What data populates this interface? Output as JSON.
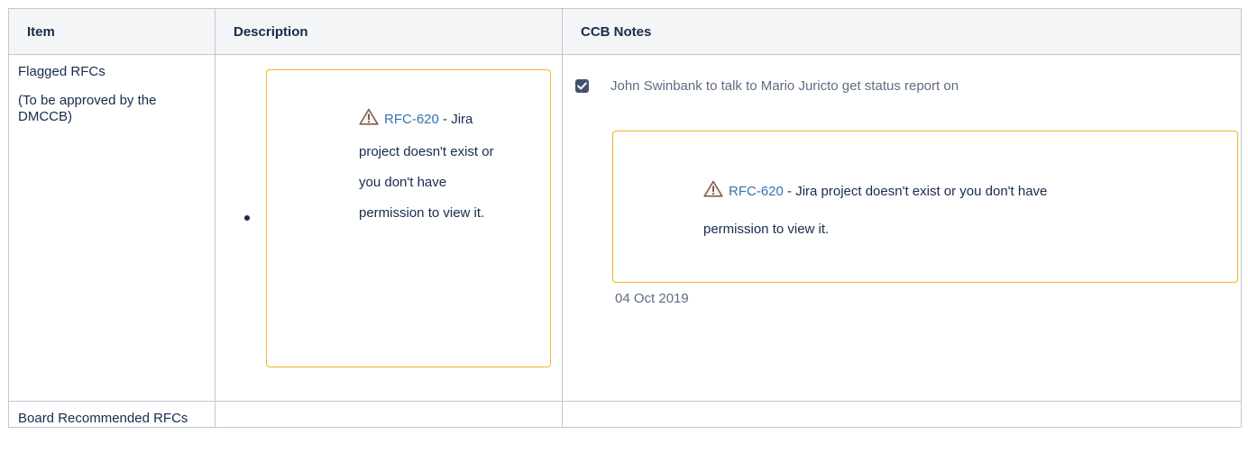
{
  "table": {
    "headers": {
      "item": "Item",
      "description": "Description",
      "notes": "CCB Notes"
    },
    "rows": [
      {
        "item_title": "Flagged RFCs",
        "item_sub": "(To be approved by the DMCCB)"
      },
      {
        "item_title": "Board Recommended RFCs"
      }
    ]
  },
  "description": {
    "jira": {
      "link_text": "RFC-620",
      "separator": " -",
      "message": "Jira project doesn't exist or you don't have permission to view it."
    }
  },
  "notes": {
    "task": {
      "checked": true,
      "text": "John Swinbank to talk to Mario Juricto get status report on"
    },
    "jira": {
      "link_text": "RFC-620",
      "message_line1": " - Jira project doesn't exist or you don't have",
      "message_line2": "permission to view it."
    },
    "due_date": "04 Oct 2019"
  },
  "colors": {
    "border": "#c1c7d0",
    "header_bg": "#f4f5f7",
    "warning_border": "#f6b22b",
    "link": "#3572b0",
    "muted_text": "#5e6c84",
    "checkbox": "#42526e"
  },
  "icons": {
    "warning": "warning-triangle-icon",
    "check": "check-icon"
  }
}
